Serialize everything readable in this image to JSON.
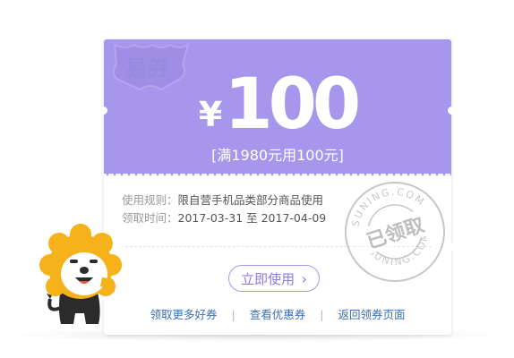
{
  "coupon": {
    "brand_badge": "易券",
    "currency": "¥",
    "amount": "100",
    "condition": "[满1980元用100元]",
    "rules_label": "使用规则：",
    "rules_value": "限自营手机品类部分商品使用",
    "time_label": "领取时间：",
    "time_value": "2017-03-31 至 2017-04-09",
    "use_button": "立即使用",
    "use_button_icon": "chevron-right-icon"
  },
  "links": {
    "more": "领取更多好券",
    "view": "查看优惠券",
    "back": "返回领券页面"
  },
  "stamp": {
    "text": "已领取",
    "ring_text": "SUNING.COM"
  },
  "colors": {
    "coupon_top": "#a797ec",
    "accent": "#8c7ae6",
    "link": "#3b6fb2",
    "mascot_yellow": "#f5b21a",
    "mascot_dark": "#2b2b2b"
  }
}
